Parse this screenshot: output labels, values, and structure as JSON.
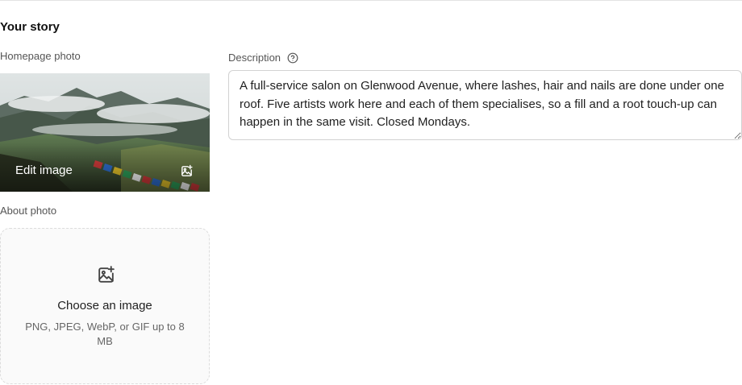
{
  "section": {
    "title": "Your story"
  },
  "homepage_photo": {
    "label": "Homepage photo",
    "edit_label": "Edit image",
    "edit_icon": "image-add-icon"
  },
  "description": {
    "label": "Description",
    "help_icon": "help-circle-icon",
    "value": "A full-service salon on Glenwood Avenue, where lashes, hair and nails are done under one roof. Five artists work here and each of them specialises, so a fill and a root touch-up can happen in the same visit. Closed Mondays."
  },
  "about_photo": {
    "label": "About photo",
    "upload_icon": "image-add-icon",
    "title": "Choose an image",
    "hint": "PNG, JPEG, WebP, or GIF up to 8 MB"
  }
}
